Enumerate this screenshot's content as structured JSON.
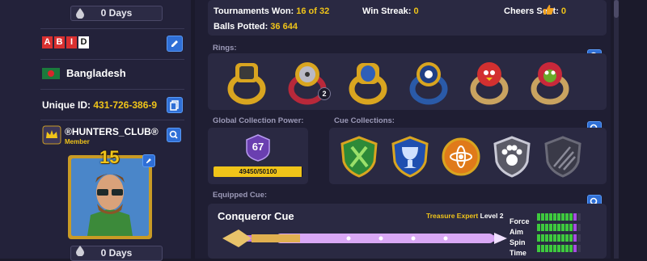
{
  "profile": {
    "days_top": "0 Days",
    "name_letters": [
      "A",
      "B",
      "I",
      "D"
    ],
    "country": "Bangladesh",
    "unique_id_label": "Unique ID:",
    "unique_id": "431-726-386-9",
    "club_name": "®HUNTERS_CLUB®",
    "club_role": "Member",
    "level": "15",
    "days_bottom": "0 Days"
  },
  "stats": {
    "tournaments_label": "Tournaments Won:",
    "tournaments_value": "16 of 32",
    "win_streak_label": "Win Streak:",
    "win_streak_value": "0",
    "cheers_label": "Cheers Sent:",
    "cheers_value": "0",
    "balls_label": "Balls Potted:",
    "balls_value": "36 644"
  },
  "rings": {
    "title": "Rings:",
    "badge_count": "2",
    "items": [
      "gold-ring-icon",
      "film-reel-ring-icon",
      "gold-blue-ring-icon",
      "eight-ball-ring-icon",
      "angry-bird-red-ring-icon",
      "angry-bird-green-ring-icon"
    ]
  },
  "collection_power": {
    "title": "Global Collection Power:",
    "level": "67",
    "progress_text": "49450/50100",
    "progress": 0.987
  },
  "cue_collections": {
    "title": "Cue Collections:",
    "items": [
      "swords-shield-icon",
      "chalice-shield-icon",
      "atom-coin-icon",
      "paw-shield-icon",
      "claw-shield-icon"
    ]
  },
  "equipped_cue": {
    "title": "Equipped Cue:",
    "name": "Conqueror Cue",
    "tier": "Treasure Expert",
    "level": "Level 2",
    "stats": [
      {
        "label": "Force",
        "filled": 9,
        "extra": 1,
        "total": 11
      },
      {
        "label": "Aim",
        "filled": 9,
        "extra": 1,
        "total": 11
      },
      {
        "label": "Spin",
        "filled": 9,
        "extra": 1,
        "total": 11
      },
      {
        "label": "Time",
        "filled": 9,
        "extra": 1,
        "total": 11
      }
    ]
  },
  "colors": {
    "gold": "#f0c419",
    "accent_blue": "#2f6fd6",
    "bar_green": "#3ec93e",
    "bar_purple": "#a64ce0"
  }
}
